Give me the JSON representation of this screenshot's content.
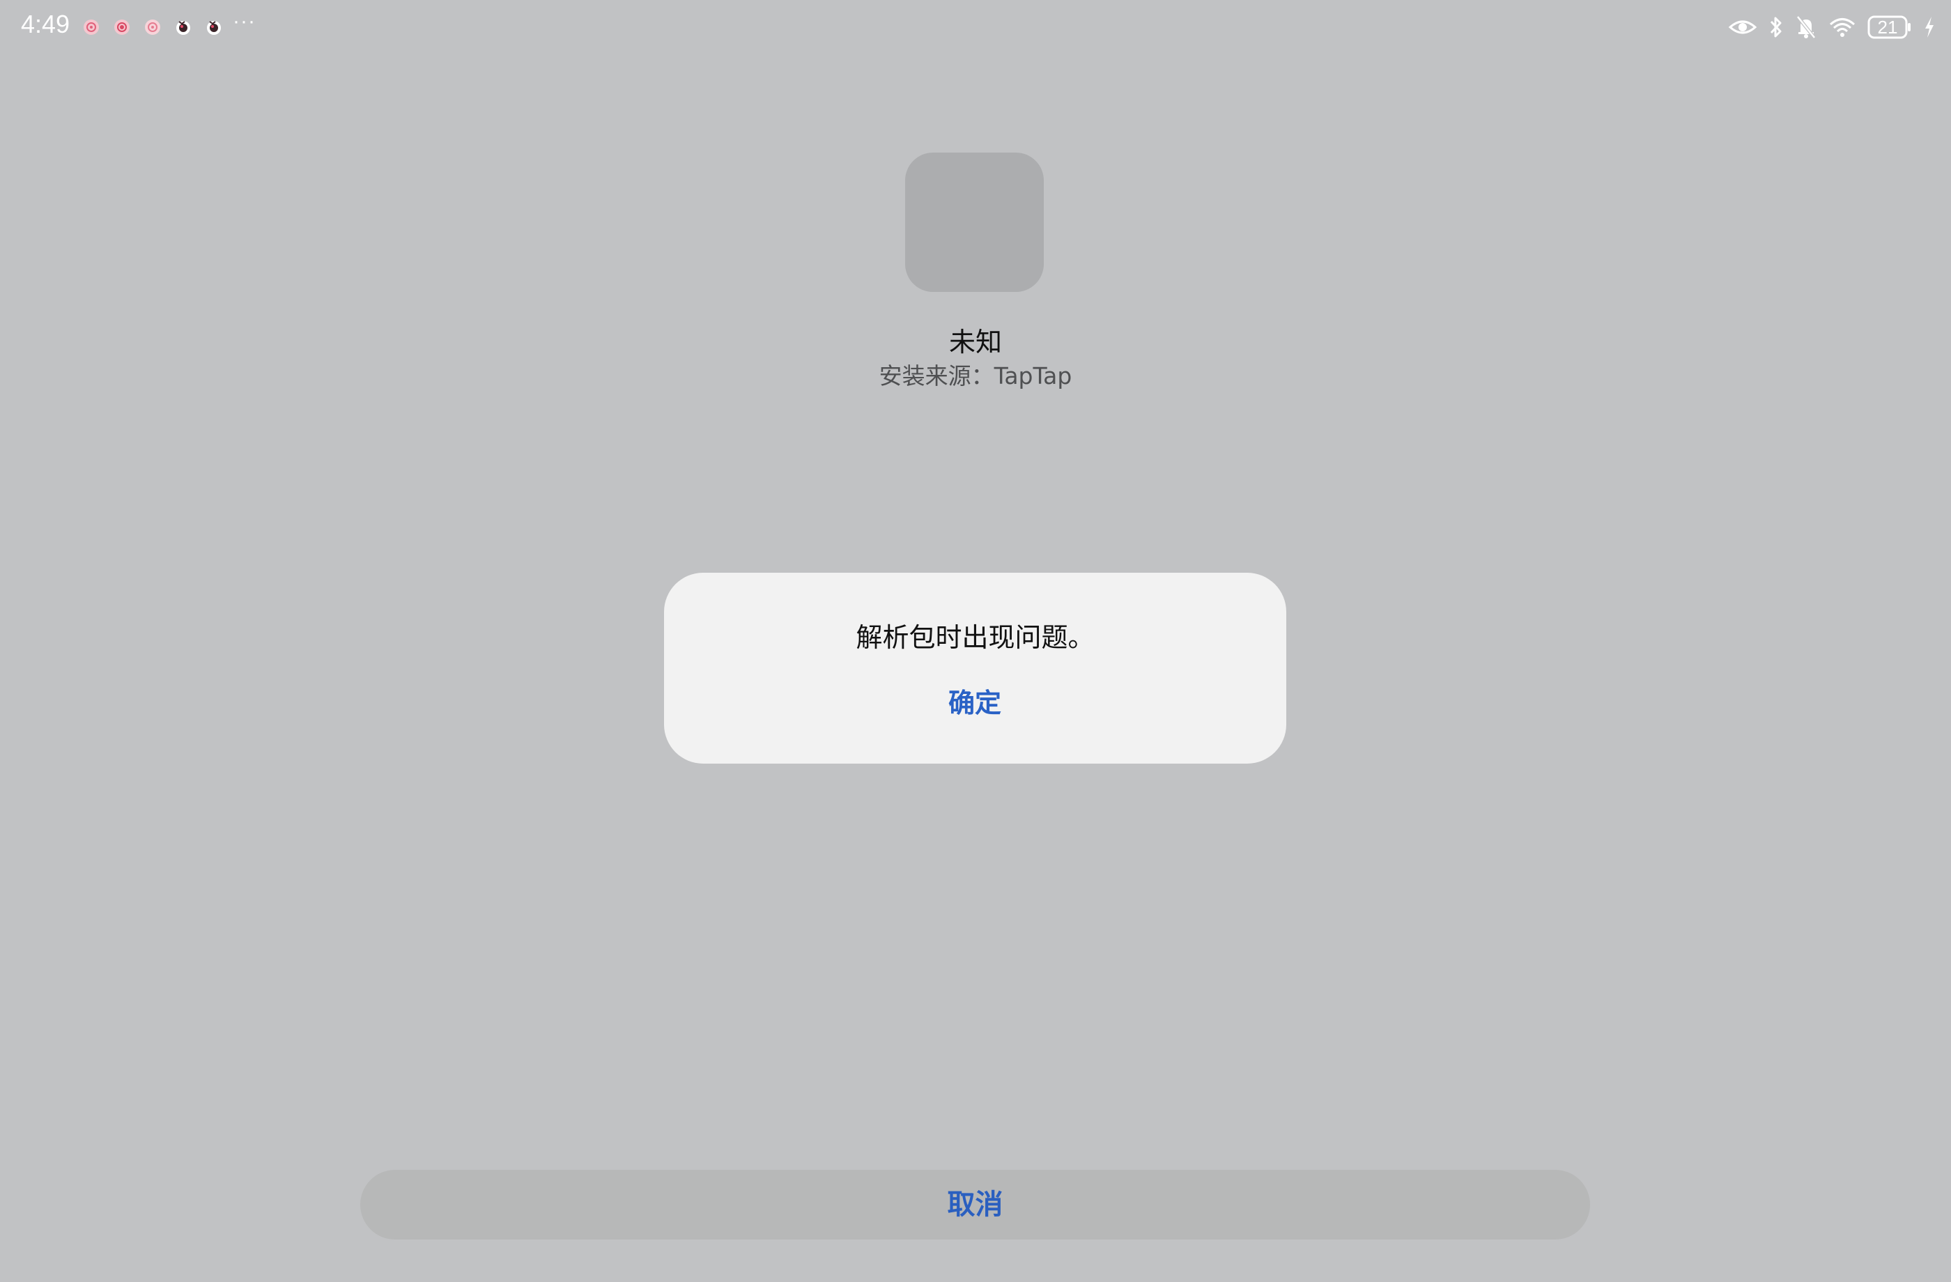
{
  "status_bar": {
    "time": "4:49",
    "more_label": "···",
    "battery_level": "21",
    "notification_icons": [
      "app-notification-icon",
      "app-notification-icon",
      "app-notification-icon",
      "app-notification-icon",
      "app-notification-icon"
    ],
    "system_icons": [
      "eye-icon",
      "bluetooth-icon",
      "mute-bell-icon",
      "wifi-icon",
      "battery-icon",
      "charging-icon"
    ]
  },
  "app": {
    "name": "未知",
    "install_source": "安装来源：TapTap"
  },
  "dialog": {
    "message": "解析包时出现问题。",
    "ok_label": "确定"
  },
  "bottom": {
    "cancel_label": "取消"
  },
  "colors": {
    "background": "#c1c2c4",
    "dialog_bg": "#f2f2f2",
    "accent": "#2a62c6",
    "cancel_bg": "#b7b8b8"
  }
}
